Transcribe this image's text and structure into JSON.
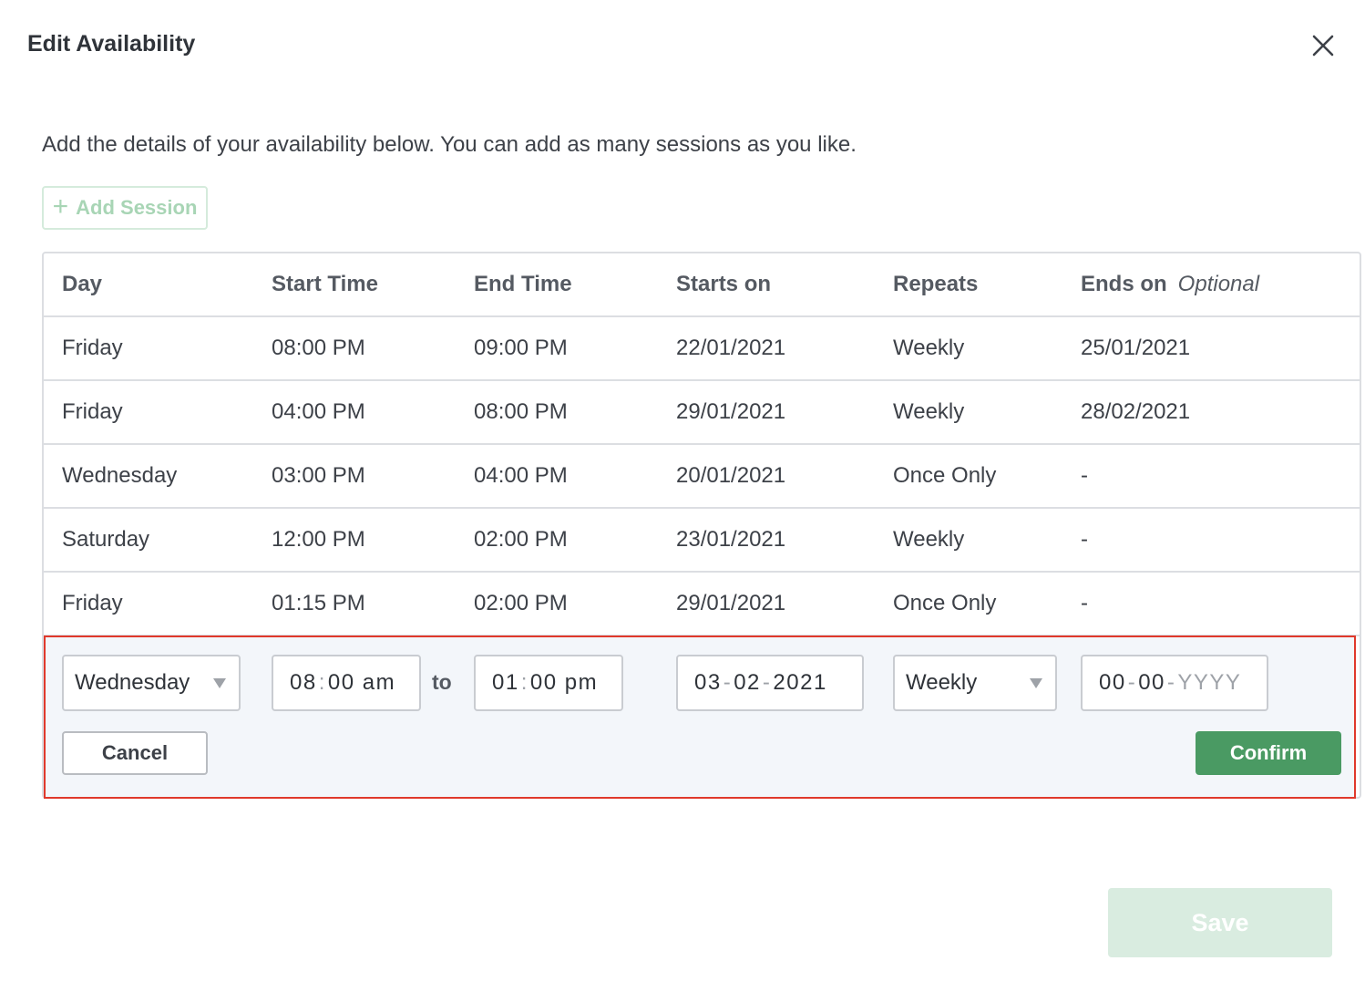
{
  "dialog": {
    "title": "Edit Availability",
    "close_icon": "close-icon",
    "intro": "Add the details of your availability below. You can add as many sessions as you like.",
    "add_session_label": "Add Session",
    "add_session_icon": "plus-icon",
    "save_label": "Save"
  },
  "table": {
    "headers": {
      "day": "Day",
      "start_time": "Start Time",
      "end_time": "End Time",
      "starts_on": "Starts on",
      "repeats": "Repeats",
      "ends_on": "Ends on",
      "ends_on_note": "Optional"
    },
    "rows": [
      {
        "day": "Friday",
        "start": "08:00 PM",
        "end": "09:00 PM",
        "starts_on": "22/01/2021",
        "repeats": "Weekly",
        "ends_on": "25/01/2021"
      },
      {
        "day": "Friday",
        "start": "04:00 PM",
        "end": "08:00 PM",
        "starts_on": "29/01/2021",
        "repeats": "Weekly",
        "ends_on": "28/02/2021"
      },
      {
        "day": "Wednesday",
        "start": "03:00 PM",
        "end": "04:00 PM",
        "starts_on": "20/01/2021",
        "repeats": "Once Only",
        "ends_on": "-"
      },
      {
        "day": "Saturday",
        "start": "12:00 PM",
        "end": "02:00 PM",
        "starts_on": "23/01/2021",
        "repeats": "Weekly",
        "ends_on": "-"
      },
      {
        "day": "Friday",
        "start": "01:15 PM",
        "end": "02:00 PM",
        "starts_on": "29/01/2021",
        "repeats": "Once Only",
        "ends_on": "-"
      }
    ]
  },
  "edit": {
    "day_value": "Wednesday",
    "start_time": {
      "hh": "08",
      "mm": "00",
      "ampm": "am"
    },
    "to_label": "to",
    "end_time": {
      "hh": "01",
      "mm": "00",
      "ampm": "pm"
    },
    "starts_on": {
      "d1": "03",
      "d2": "02",
      "d3": "2021"
    },
    "repeats_value": "Weekly",
    "ends_on": {
      "d1": "00",
      "d2": "00",
      "d3": "YYYY"
    },
    "cancel_label": "Cancel",
    "confirm_label": "Confirm"
  },
  "colors": {
    "accent_green": "#4a9a63",
    "disabled_green": "#d9ece0",
    "highlight_border": "#e0392b",
    "edit_row_bg": "#f3f6fa"
  }
}
